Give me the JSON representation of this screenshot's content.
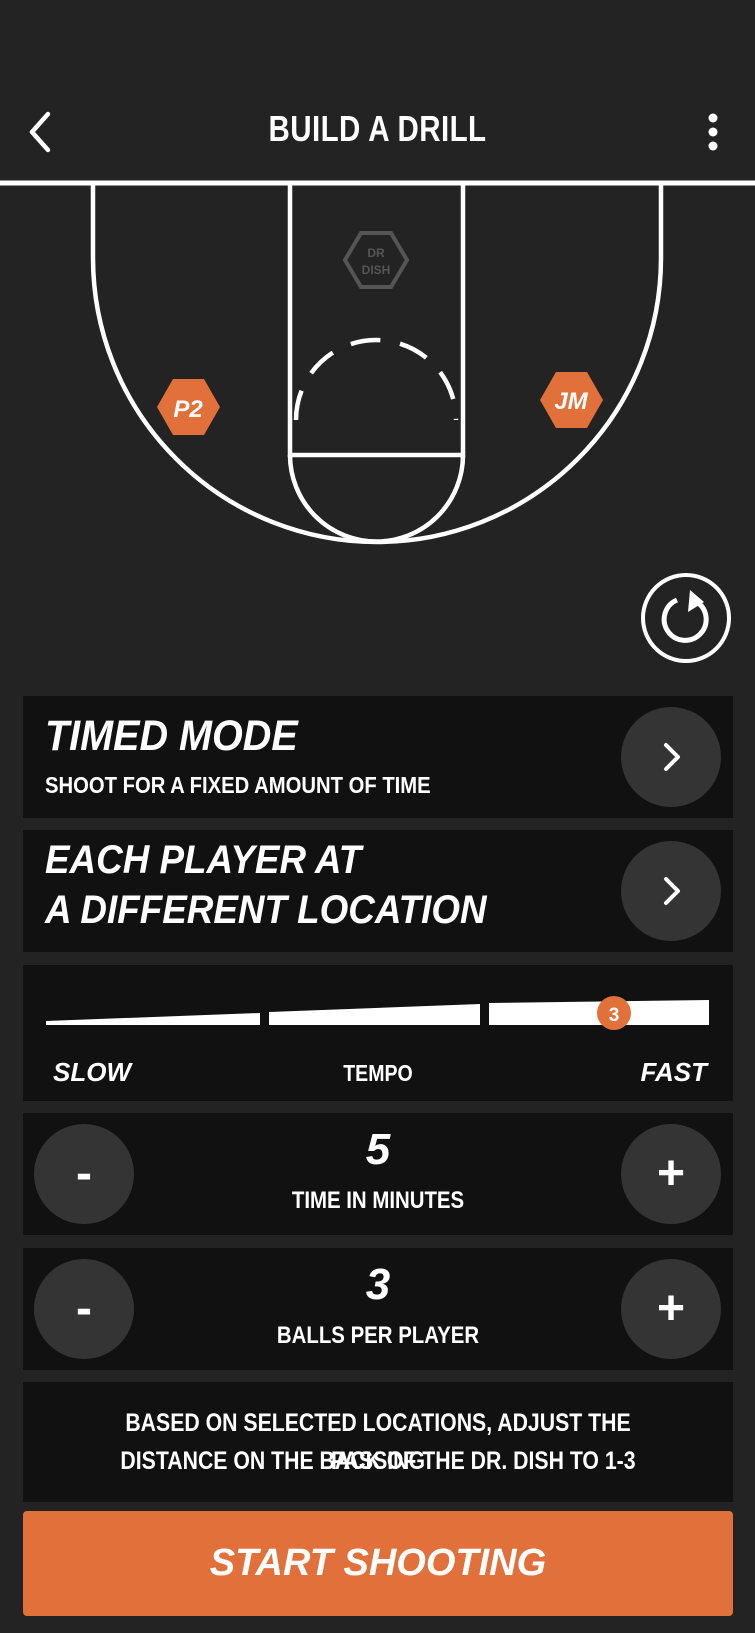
{
  "header": {
    "title": "BUILD A DRILL"
  },
  "court": {
    "machine_label_line1": "DR",
    "machine_label_line2": "DISH",
    "players": [
      {
        "label": "P2",
        "color": "#e2703a"
      },
      {
        "label": "JM",
        "color": "#e2703a"
      }
    ]
  },
  "mode": {
    "title": "TIMED MODE",
    "subtitle": "SHOOT FOR A FIXED AMOUNT OF TIME"
  },
  "location": {
    "line1": "EACH PLAYER AT",
    "line2": "A DIFFERENT LOCATION"
  },
  "tempo": {
    "slow": "SLOW",
    "label": "TEMPO",
    "fast": "FAST",
    "value": "3"
  },
  "time": {
    "value": "5",
    "label": "TIME IN MINUTES",
    "minus": "-",
    "plus": "+"
  },
  "balls": {
    "value": "3",
    "label": "BALLS PER PLAYER",
    "minus": "-",
    "plus": "+"
  },
  "note": {
    "line1": "BASED ON SELECTED LOCATIONS, ADJUST THE PASSING",
    "line2": "DISTANCE ON THE BACK OF THE DR. DISH TO 1-3"
  },
  "start_button": "START SHOOTING",
  "colors": {
    "accent": "#e2703a",
    "background": "#232323",
    "card": "#111111",
    "button": "#343434"
  }
}
